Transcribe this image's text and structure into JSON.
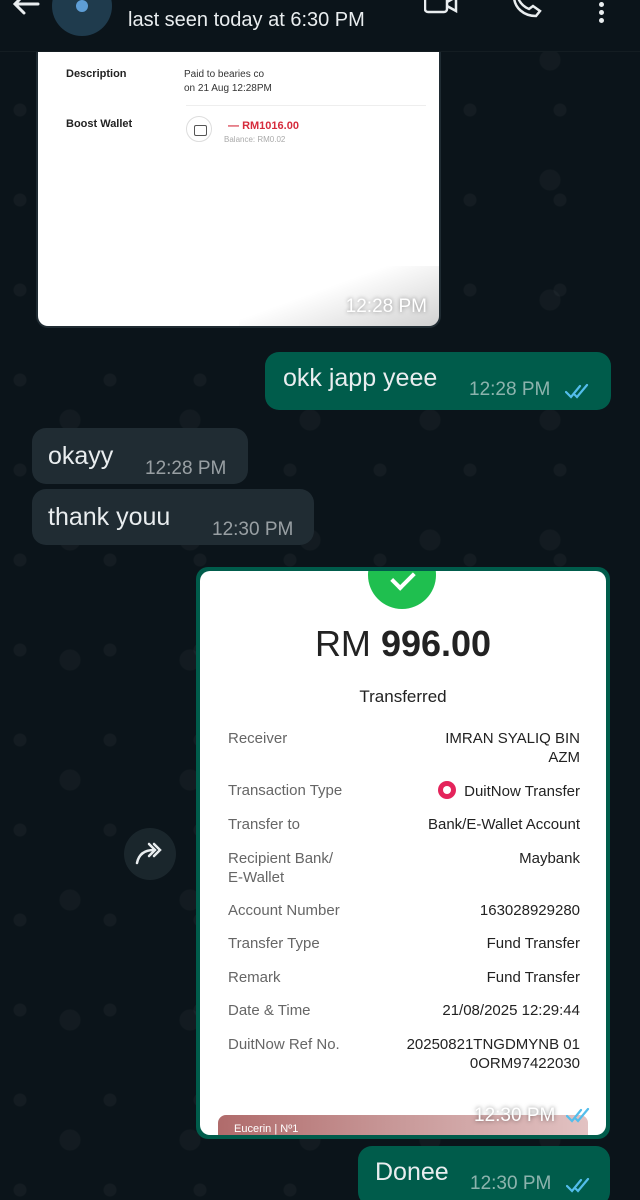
{
  "header": {
    "last_seen": "last seen today at 6:30 PM"
  },
  "receipt_1": {
    "description_label": "Description",
    "description_value_line1": "Paid to bearies co",
    "description_value_line2": "on 21 Aug 12:28PM",
    "wallet_label": "Boost Wallet",
    "amount": "RM1016.00",
    "balance": "Balance: RM0.02",
    "time": "12:28 PM"
  },
  "messages": [
    {
      "dir": "out",
      "text": "okk japp yeee",
      "time": "12:28 PM",
      "status": "read"
    },
    {
      "dir": "in",
      "text": "okayy",
      "time": "12:28 PM"
    },
    {
      "dir": "in",
      "text": "thank youu",
      "time": "12:30 PM"
    }
  ],
  "receipt_2": {
    "currency": "RM",
    "amount": "996.00",
    "status": "Transferred",
    "rows": [
      {
        "label": "Receiver",
        "value": "IMRAN SYALIQ BIN AZM"
      },
      {
        "label": "Transaction Type",
        "value": "DuitNow Transfer"
      },
      {
        "label": "Transfer to",
        "value": "Bank/E-Wallet Account"
      },
      {
        "label": "Recipient Bank/ E-Wallet",
        "value": "Maybank"
      },
      {
        "label": "Account Number",
        "value": "163028929280"
      },
      {
        "label": "Transfer Type",
        "value": "Fund Transfer"
      },
      {
        "label": "Remark",
        "value": "Fund Transfer"
      },
      {
        "label": "Date & Time",
        "value": "21/08/2025 12:29:44"
      },
      {
        "label": "DuitNow Ref No.",
        "value": "20250821TNGDMYNB 010ORM97422030"
      }
    ],
    "ad_text": "Eucerin | Nº1",
    "time": "12:30 PM",
    "status_icon": "double-check-icon"
  },
  "last_message": {
    "text": "Donee",
    "time": "12:30 PM",
    "status": "read"
  },
  "colors": {
    "background": "#0b141a",
    "incoming_bubble": "#202c33",
    "outgoing_bubble": "#005c4b",
    "read_ticks": "#53bdeb",
    "success_green": "#1fbf4f",
    "debit_red": "#d62b3c"
  },
  "icons": {
    "back": "arrow-left-icon",
    "video": "video-call-icon",
    "call": "phone-icon",
    "menu": "more-vert-icon",
    "forward": "forward-icon"
  }
}
